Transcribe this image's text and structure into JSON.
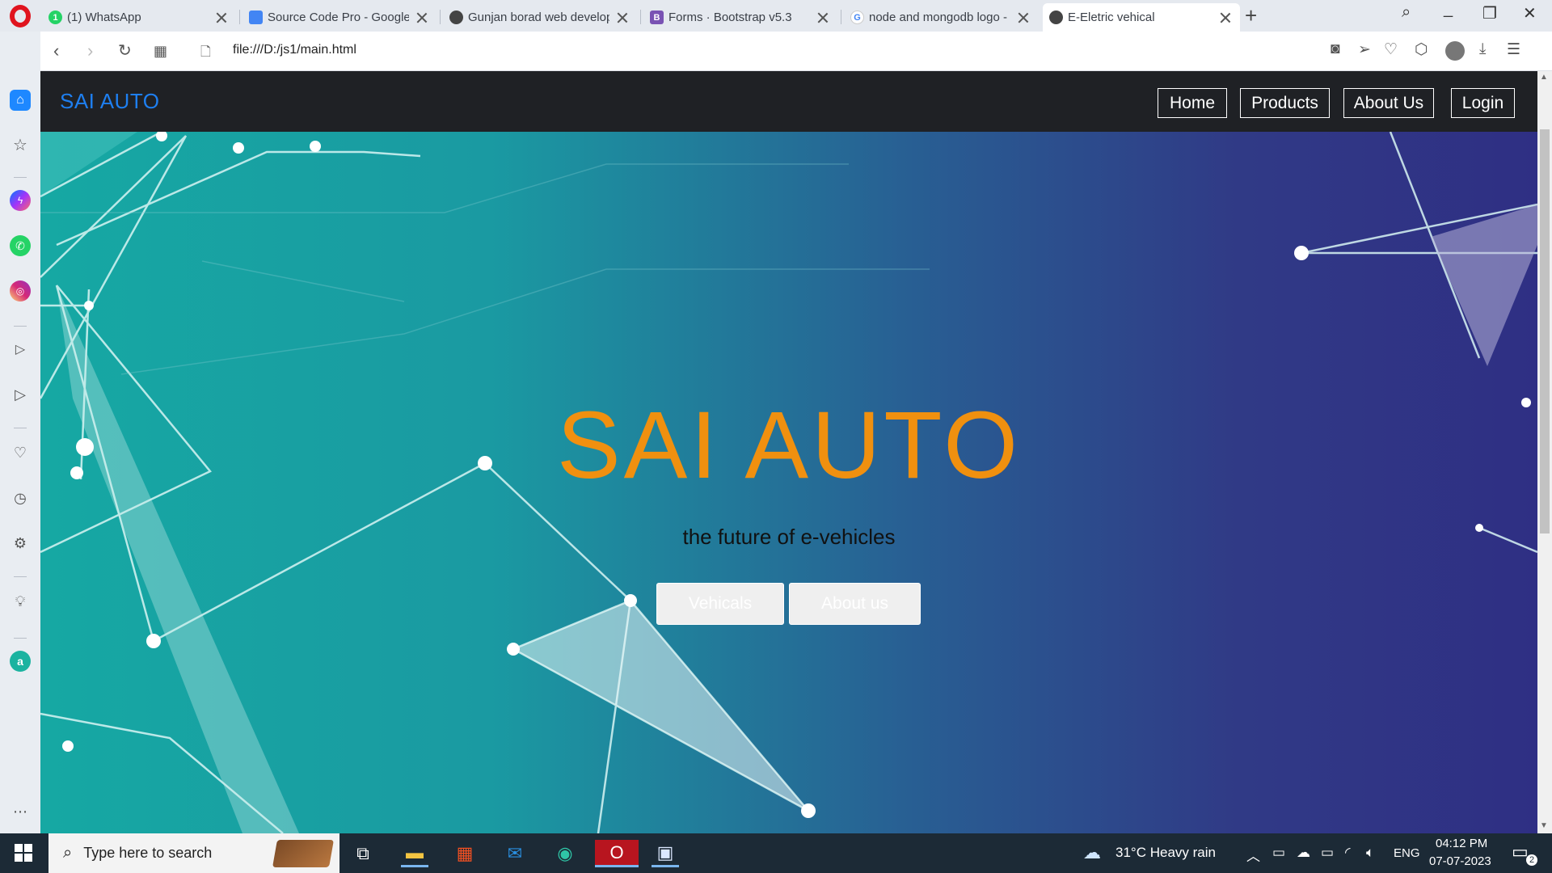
{
  "browser": {
    "tabs": [
      {
        "title": "(1) WhatsApp",
        "favicon": "whatsapp-icon",
        "color": "#25d366",
        "badge": "1"
      },
      {
        "title": "Source Code Pro - Google F",
        "favicon": "google-fonts-icon",
        "color": "#4285f4"
      },
      {
        "title": "Gunjan borad web develop",
        "favicon": "globe-icon",
        "color": "#444444"
      },
      {
        "title": "Forms · Bootstrap v5.3",
        "favicon": "bootstrap-icon",
        "color": "#7952b3",
        "badge": "B"
      },
      {
        "title": "node and mongodb logo -",
        "favicon": "google-icon",
        "color": "#4285f4",
        "badge": "G"
      },
      {
        "title": "E-Eletric vehical",
        "favicon": "globe-icon",
        "color": "#444444",
        "active": true
      }
    ],
    "url": "file:///D:/js1/main.html"
  },
  "site": {
    "brand": "SAI AUTO",
    "brand_color": "#1e7ff0",
    "nav": [
      "Home",
      "Products",
      "About Us",
      "Login"
    ],
    "hero": {
      "title": "SAI AUTO",
      "title_color": "#f0900f",
      "subtitle": "the future of e-vehicles",
      "buttons": [
        "Vehicals",
        "About us"
      ]
    }
  },
  "taskbar": {
    "search_placeholder": "Type here to search",
    "weather": "31°C  Heavy rain",
    "language": "ENG",
    "time": "04:12 PM",
    "date": "07-07-2023",
    "notifications": "2"
  }
}
